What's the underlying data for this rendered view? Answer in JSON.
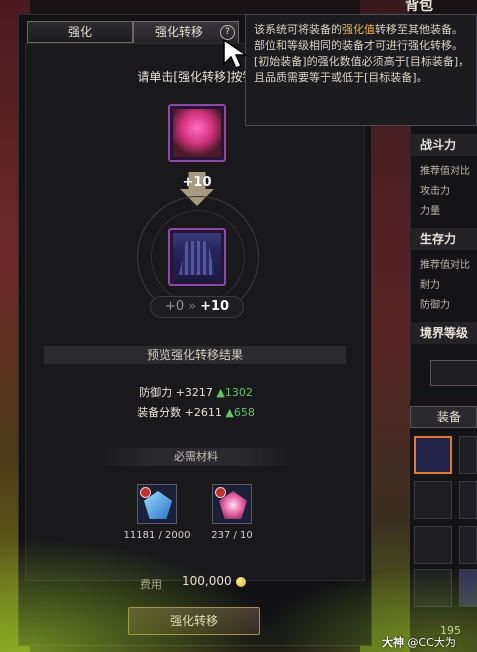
{
  "tabs": {
    "enhance": "强化",
    "transfer": "强化转移"
  },
  "help_icon": "?",
  "instruction": "请单击[强化转移]按钮",
  "source_item": {
    "icon": "flower-armor-icon"
  },
  "transfer_amount": "+10",
  "target_item": {
    "icon": "skirt-armor-icon"
  },
  "level": {
    "from": "+0",
    "separator": "»",
    "to": "+10"
  },
  "preview_title": "预览强化转移结果",
  "stats": [
    {
      "label": "防御力 +3217",
      "delta": "1302"
    },
    {
      "label": "装备分数 +2611",
      "delta": "658"
    }
  ],
  "materials_title": "必需材料",
  "materials": [
    {
      "icon": "blue-crystal-icon",
      "count": "11181 / 2000"
    },
    {
      "icon": "pink-crystal-icon",
      "count": "237 / 10"
    }
  ],
  "fee": {
    "label": "费用",
    "value": "100,000"
  },
  "action_button": "强化转移",
  "tooltip": {
    "line1_prefix": "该系统可将装备的",
    "line1_highlight": "强化值",
    "line1_suffix": "转移至其他装备。",
    "line2": "部位和等级相同的装备才可进行强化转移。",
    "line3": "[初始装备]的强化数值必须高于[目标装备]，且品质需要等于或低于[目标装备]。"
  },
  "right_panel": {
    "header": "背包",
    "sections": [
      {
        "title": "战斗力",
        "items": [
          "推荐值对比",
          "攻击力",
          "力量"
        ]
      },
      {
        "title": "生存力",
        "items": [
          "推荐值对比",
          "耐力",
          "防御力"
        ]
      },
      {
        "title": "境界等级",
        "items": []
      }
    ],
    "equip_tab": "装备",
    "count": "195"
  },
  "watermark": {
    "brand": "大神",
    "user": "@CC大为"
  },
  "colors": {
    "accent": "#f0b040",
    "up": "#5ec36a",
    "selected_border": "#e07a30"
  }
}
